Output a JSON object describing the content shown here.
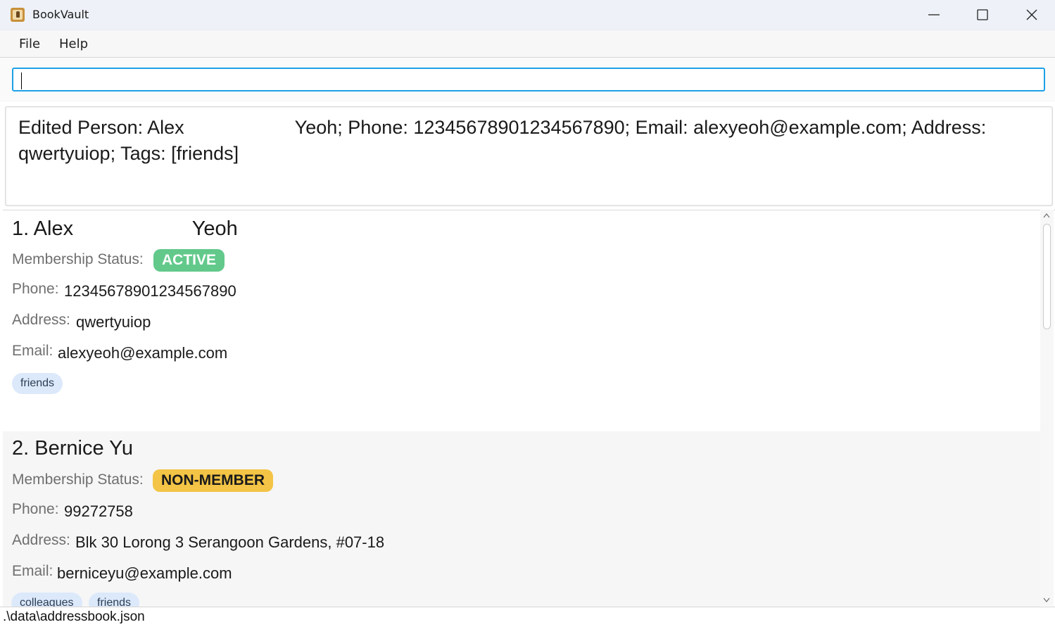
{
  "window": {
    "title": "BookVault",
    "icon": "book-contact-icon",
    "controls": {
      "minimize": "minimize-icon",
      "maximize": "maximize-icon",
      "close": "close-icon"
    }
  },
  "menu": {
    "items": [
      "File",
      "Help"
    ]
  },
  "command": {
    "value": "",
    "placeholder": ""
  },
  "result": {
    "text": "Edited Person: Alex                     Yeoh; Phone: 12345678901234567890; Email: alexyeoh@example.com; Address: qwertyuiop; Tags: [friends]"
  },
  "persons": [
    {
      "index": "1. ",
      "name": "Alex                     Yeoh",
      "status_label": "Membership Status:",
      "status": "ACTIVE",
      "phone_label": "Phone:",
      "phone": "12345678901234567890",
      "address_label": "Address:",
      "address": "qwertyuiop",
      "email_label": "Email:",
      "email": "alexyeoh@example.com",
      "tags": [
        "friends"
      ]
    },
    {
      "index": "2. ",
      "name": "Bernice Yu",
      "status_label": "Membership Status:",
      "status": "NON-MEMBER",
      "phone_label": "Phone:",
      "phone": "99272758",
      "address_label": "Address:",
      "address": "Blk 30 Lorong 3 Serangoon Gardens, #07-18",
      "email_label": "Email:",
      "email": "berniceyu@example.com",
      "tags": [
        "colleagues",
        "friends"
      ]
    }
  ],
  "status_bar": {
    "path": ".\\data\\addressbook.json"
  },
  "colors": {
    "accent": "#1ea1e6",
    "active_badge_bg": "#62c98b",
    "active_badge_text": "#ffffff",
    "nonmember_badge_bg": "#f3c445",
    "nonmember_badge_text": "#1a1a1a",
    "tag_bg": "#dce9fb",
    "tag_text": "#2c3e55"
  }
}
